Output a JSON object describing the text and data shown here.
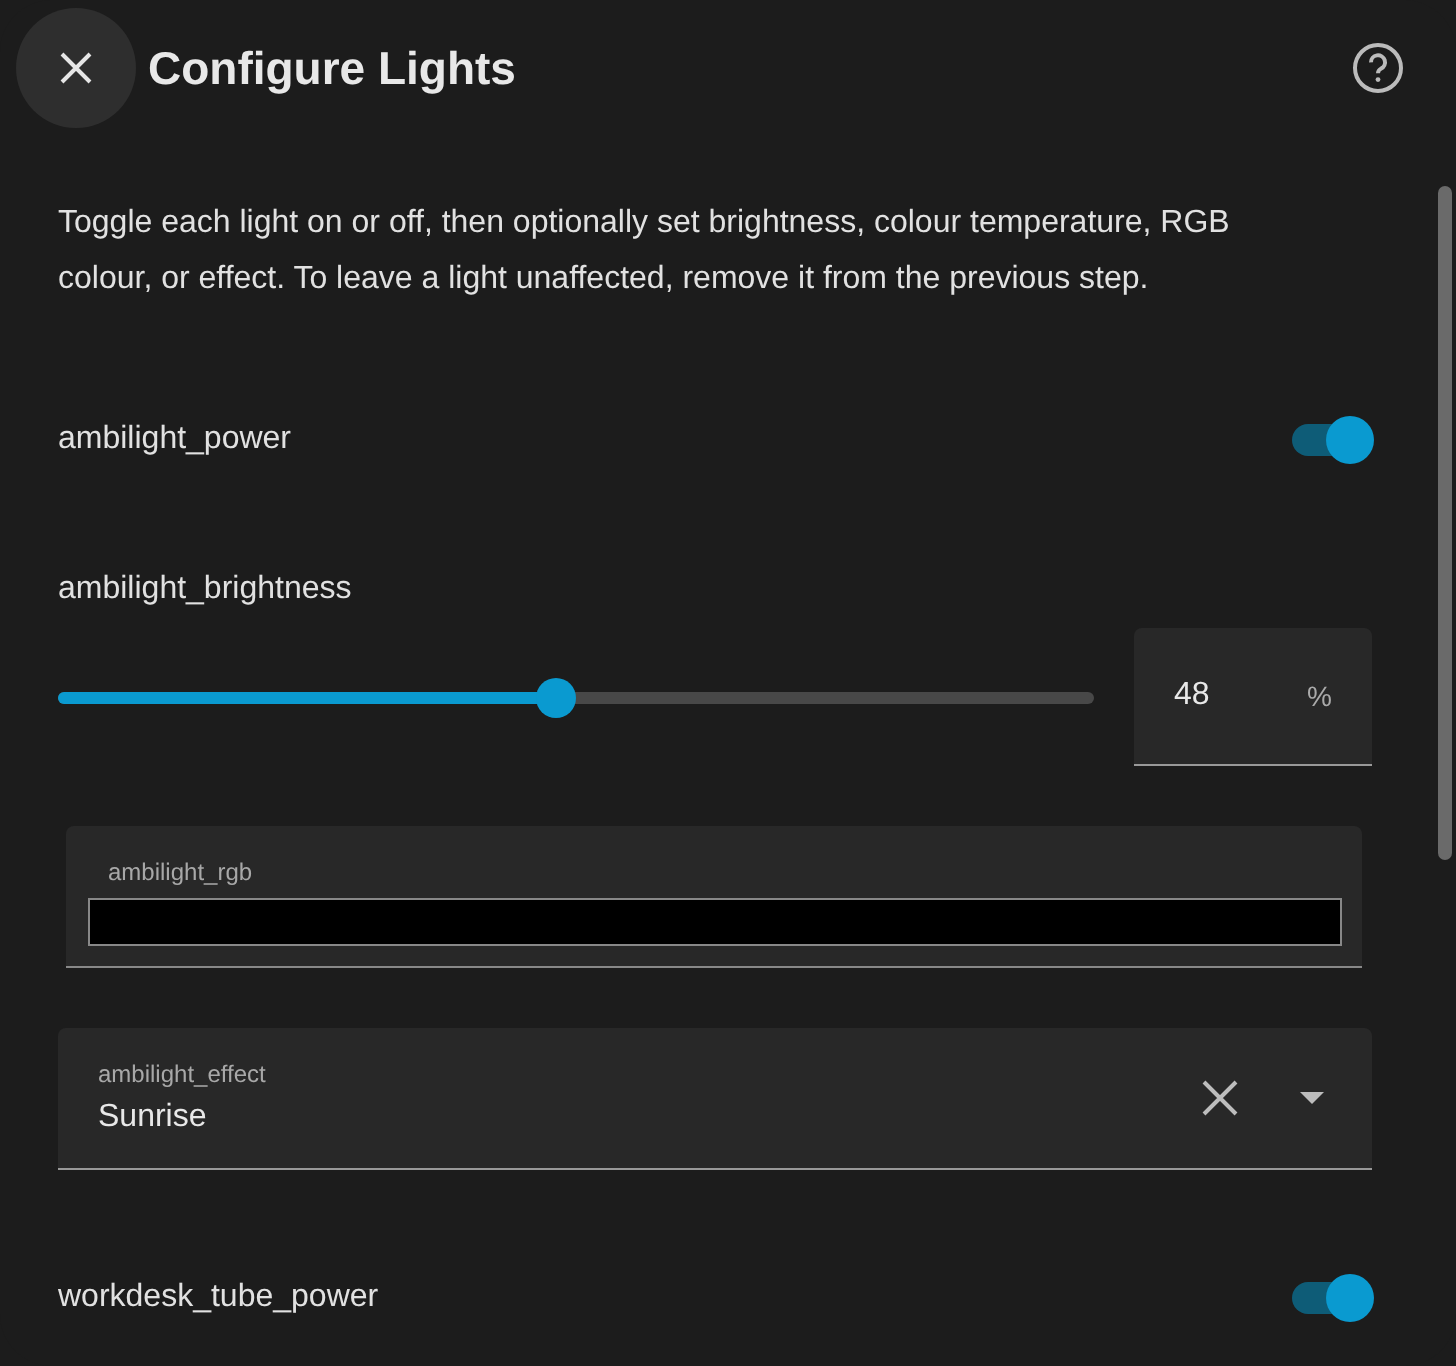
{
  "dialog": {
    "title": "Configure Lights",
    "description": "Toggle each light on or off, then optionally set brightness, colour temperature, RGB colour, or effect. To leave a light unaffected, remove it from the previous step."
  },
  "items": [
    {
      "kind": "toggle",
      "label": "ambilight_power",
      "on": true
    },
    {
      "kind": "slider",
      "label": "ambilight_brightness",
      "level": 0.48,
      "value": "48",
      "unit": "%"
    },
    {
      "kind": "color",
      "label": "ambilight_rgb",
      "color": "#000000"
    },
    {
      "kind": "select",
      "label": "ambilight_effect",
      "value": "Sunrise"
    },
    {
      "kind": "toggle",
      "label": "workdesk_tube_power",
      "on": true
    }
  ]
}
